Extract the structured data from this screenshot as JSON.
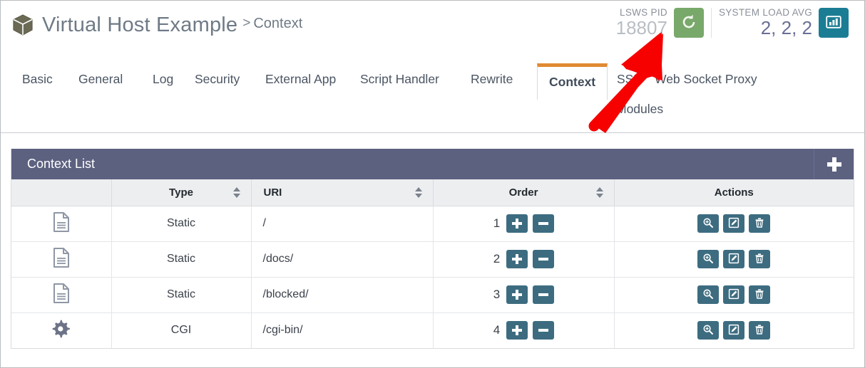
{
  "header": {
    "breadcrumb": {
      "icon": "cube-icon",
      "host_name": "Virtual Host Example",
      "separator": ">",
      "current": "Context"
    },
    "stats": [
      {
        "label": "LSWS PID",
        "value": "18807",
        "button_icon": "refresh-icon",
        "button_color": "#78a86a"
      },
      {
        "label": "SYSTEM LOAD AVG",
        "value": "2, 2, 2",
        "button_icon": "bar-chart-icon",
        "button_color": "#1b7d94"
      }
    ]
  },
  "tabs": [
    {
      "label": "Basic",
      "active": false
    },
    {
      "label": "General",
      "active": false
    },
    {
      "label": "Log",
      "active": false
    },
    {
      "label": "Security",
      "active": false
    },
    {
      "label": "External App",
      "active": false
    },
    {
      "label": "Script Handler",
      "active": false
    },
    {
      "label": "Rewrite",
      "active": false
    },
    {
      "label": "Context",
      "active": true
    },
    {
      "label": "SSL",
      "active": false
    },
    {
      "label": "Web Socket Proxy",
      "active": false
    },
    {
      "label": "Modules",
      "active": false
    }
  ],
  "panel": {
    "title": "Context List",
    "add_button_icon": "plus-icon",
    "header_color": "#5c6180",
    "columns": [
      {
        "label": "",
        "sortable": false
      },
      {
        "label": "Type",
        "sortable": true
      },
      {
        "label": "URI",
        "sortable": true
      },
      {
        "label": "Order",
        "sortable": true
      },
      {
        "label": "Actions",
        "sortable": false
      }
    ],
    "rows": [
      {
        "icon": "document-icon",
        "type": "Static",
        "uri": "/",
        "order": "1",
        "order_actions": [
          "plus-icon",
          "minus-icon"
        ],
        "actions": [
          "view-icon",
          "edit-icon",
          "delete-icon"
        ]
      },
      {
        "icon": "document-icon",
        "type": "Static",
        "uri": "/docs/",
        "order": "2",
        "order_actions": [
          "plus-icon",
          "minus-icon"
        ],
        "actions": [
          "view-icon",
          "edit-icon",
          "delete-icon"
        ]
      },
      {
        "icon": "document-icon",
        "type": "Static",
        "uri": "/blocked/",
        "order": "3",
        "order_actions": [
          "plus-icon",
          "minus-icon"
        ],
        "actions": [
          "view-icon",
          "edit-icon",
          "delete-icon"
        ]
      },
      {
        "icon": "gear-icon",
        "type": "CGI",
        "uri": "/cgi-bin/",
        "order": "4",
        "order_actions": [
          "plus-icon",
          "minus-icon"
        ],
        "actions": [
          "view-icon",
          "edit-icon",
          "delete-icon"
        ]
      }
    ]
  },
  "annotation": {
    "type": "arrow",
    "color": "#f70000",
    "points_to": "refresh-button"
  }
}
